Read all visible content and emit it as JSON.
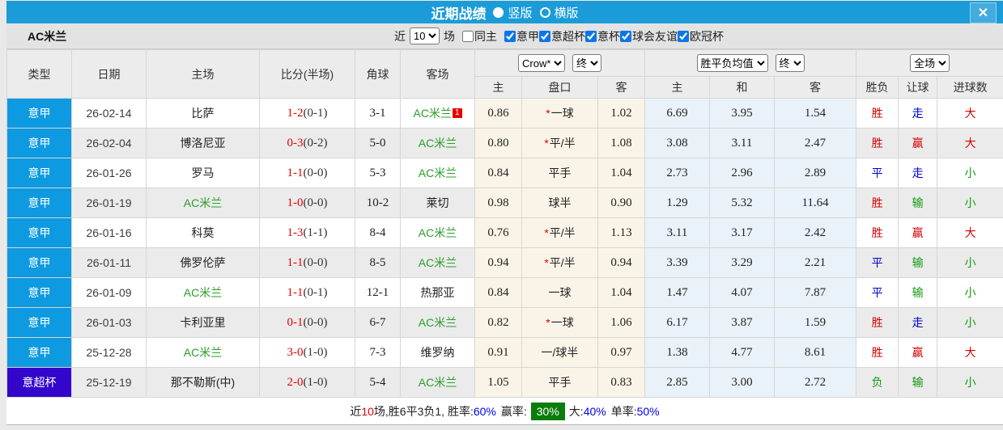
{
  "titlebar": {
    "title": "近期战绩",
    "vertical_label": "竖版",
    "horizontal_label": "横版",
    "close_label": "✕",
    "bar_color": "#1b9cd8"
  },
  "filter": {
    "team": "AC米兰",
    "near_label": "近",
    "count": "10",
    "unit_label": "场",
    "same_home_label": "同主",
    "leagues": [
      "意甲",
      "意超杯",
      "意杯",
      "球会友谊",
      "欧冠杯"
    ]
  },
  "table": {
    "columns": [
      "类型",
      "日期",
      "主场",
      "比分(半场)",
      "角球",
      "客场"
    ],
    "sub_columns": [
      "主",
      "盘口",
      "客",
      "主",
      "和",
      "客",
      "胜负",
      "让球",
      "进球数"
    ],
    "selects": {
      "company": "Crow*",
      "company_period": "终",
      "avg": "胜平负均值",
      "avg_period": "终",
      "scope": "全场"
    },
    "colors": {
      "league_badge": "#0d9ae0",
      "cup_badge": "#3306cc",
      "team_green": "#2a9c2a",
      "score_red": "#e60000",
      "win_red": "#d40000",
      "draw_blue": "#0000cc",
      "lose_green": "#0f9b0f",
      "crow_bg": "#faf4e8",
      "avg_bg": "#e9f2f8"
    },
    "rows": [
      {
        "league": "意甲",
        "cup": false,
        "date": "26-02-14",
        "home": "比萨",
        "home_team": false,
        "ft": "1-2",
        "ht": "(0-1)",
        "corner": "3-1",
        "away": "AC米兰",
        "away_team": true,
        "redcard": "1",
        "o1": "0.86",
        "star": true,
        "handicap": "一球",
        "o2": "1.02",
        "a1": "6.69",
        "a2": "3.95",
        "a3": "1.54",
        "res": "胜",
        "res_c": "r",
        "let": "走",
        "let_c": "b",
        "goal": "大",
        "goal_c": "r"
      },
      {
        "league": "意甲",
        "cup": false,
        "date": "26-02-04",
        "home": "博洛尼亚",
        "home_team": false,
        "ft": "0-3",
        "ht": "(0-2)",
        "corner": "5-0",
        "away": "AC米兰",
        "away_team": true,
        "redcard": null,
        "o1": "0.80",
        "star": true,
        "handicap": "平/半",
        "o2": "1.08",
        "a1": "3.08",
        "a2": "3.11",
        "a3": "2.47",
        "res": "胜",
        "res_c": "r",
        "let": "赢",
        "let_c": "r",
        "goal": "大",
        "goal_c": "r"
      },
      {
        "league": "意甲",
        "cup": false,
        "date": "26-01-26",
        "home": "罗马",
        "home_team": false,
        "ft": "1-1",
        "ht": "(0-0)",
        "corner": "5-3",
        "away": "AC米兰",
        "away_team": true,
        "redcard": null,
        "o1": "0.84",
        "star": false,
        "handicap": "平手",
        "o2": "1.04",
        "a1": "2.73",
        "a2": "2.96",
        "a3": "2.89",
        "res": "平",
        "res_c": "b",
        "let": "走",
        "let_c": "b",
        "goal": "小",
        "goal_c": "g"
      },
      {
        "league": "意甲",
        "cup": false,
        "date": "26-01-19",
        "home": "AC米兰",
        "home_team": true,
        "ft": "1-0",
        "ht": "(0-0)",
        "corner": "10-2",
        "away": "莱切",
        "away_team": false,
        "redcard": null,
        "o1": "0.98",
        "star": false,
        "handicap": "球半",
        "o2": "0.90",
        "a1": "1.29",
        "a2": "5.32",
        "a3": "11.64",
        "res": "胜",
        "res_c": "r",
        "let": "输",
        "let_c": "g",
        "goal": "小",
        "goal_c": "g"
      },
      {
        "league": "意甲",
        "cup": false,
        "date": "26-01-16",
        "home": "科莫",
        "home_team": false,
        "ft": "1-3",
        "ht": "(1-1)",
        "corner": "8-4",
        "away": "AC米兰",
        "away_team": true,
        "redcard": null,
        "o1": "0.76",
        "star": true,
        "handicap": "平/半",
        "o2": "1.13",
        "a1": "3.11",
        "a2": "3.17",
        "a3": "2.42",
        "res": "胜",
        "res_c": "r",
        "let": "赢",
        "let_c": "r",
        "goal": "大",
        "goal_c": "r"
      },
      {
        "league": "意甲",
        "cup": false,
        "date": "26-01-11",
        "home": "佛罗伦萨",
        "home_team": false,
        "ft": "1-1",
        "ht": "(0-0)",
        "corner": "8-5",
        "away": "AC米兰",
        "away_team": true,
        "redcard": null,
        "o1": "0.94",
        "star": true,
        "handicap": "平/半",
        "o2": "0.94",
        "a1": "3.39",
        "a2": "3.29",
        "a3": "2.21",
        "res": "平",
        "res_c": "b",
        "let": "输",
        "let_c": "g",
        "goal": "小",
        "goal_c": "g"
      },
      {
        "league": "意甲",
        "cup": false,
        "date": "26-01-09",
        "home": "AC米兰",
        "home_team": true,
        "ft": "1-1",
        "ht": "(0-1)",
        "corner": "12-1",
        "away": "热那亚",
        "away_team": false,
        "redcard": null,
        "o1": "0.84",
        "star": false,
        "handicap": "一球",
        "o2": "1.04",
        "a1": "1.47",
        "a2": "4.07",
        "a3": "7.87",
        "res": "平",
        "res_c": "b",
        "let": "输",
        "let_c": "g",
        "goal": "小",
        "goal_c": "g"
      },
      {
        "league": "意甲",
        "cup": false,
        "date": "26-01-03",
        "home": "卡利亚里",
        "home_team": false,
        "ft": "0-1",
        "ht": "(0-0)",
        "corner": "6-7",
        "away": "AC米兰",
        "away_team": true,
        "redcard": null,
        "o1": "0.82",
        "star": true,
        "handicap": "一球",
        "o2": "1.06",
        "a1": "6.17",
        "a2": "3.87",
        "a3": "1.59",
        "res": "胜",
        "res_c": "r",
        "let": "走",
        "let_c": "b",
        "goal": "小",
        "goal_c": "g"
      },
      {
        "league": "意甲",
        "cup": false,
        "date": "25-12-28",
        "home": "AC米兰",
        "home_team": true,
        "ft": "3-0",
        "ht": "(1-0)",
        "corner": "7-3",
        "away": "维罗纳",
        "away_team": false,
        "redcard": null,
        "o1": "0.91",
        "star": false,
        "handicap": "一/球半",
        "o2": "0.97",
        "a1": "1.38",
        "a2": "4.77",
        "a3": "8.61",
        "res": "胜",
        "res_c": "r",
        "let": "赢",
        "let_c": "r",
        "goal": "大",
        "goal_c": "r"
      },
      {
        "league": "意超杯",
        "cup": true,
        "date": "25-12-19",
        "home": "那不勒斯(中)",
        "home_team": false,
        "ft": "2-0",
        "ht": "(1-0)",
        "corner": "5-4",
        "away": "AC米兰",
        "away_team": true,
        "redcard": null,
        "o1": "1.05",
        "star": false,
        "handicap": "平手",
        "o2": "0.83",
        "a1": "2.85",
        "a2": "3.00",
        "a3": "2.72",
        "res": "负",
        "res_c": "g",
        "let": "输",
        "let_c": "g",
        "goal": "小",
        "goal_c": "g"
      }
    ]
  },
  "footer": {
    "near_label": "近",
    "count": "10",
    "summary": "场,胜6平3负1, 胜率:",
    "win_rate": "60%",
    "win_box_label": "赢率:",
    "win_box_value": "30%",
    "big_label": "大:",
    "big_rate": "40%",
    "single_label": "单率:",
    "single_rate": "50%",
    "box_color": "#0a7d0a"
  }
}
